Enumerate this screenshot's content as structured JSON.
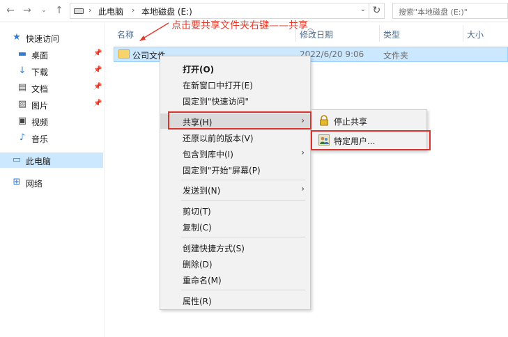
{
  "address_bar": {
    "crumbs": [
      "此电脑",
      "本地磁盘 (E:)"
    ],
    "search_placeholder": "搜索\"本地磁盘 (E:)\""
  },
  "sidebar": {
    "items": [
      {
        "label": "快速访问",
        "icon": "star-icon",
        "pinned": false
      },
      {
        "label": "桌面",
        "icon": "desktop-icon",
        "pinned": true
      },
      {
        "label": "下载",
        "icon": "download-icon",
        "pinned": true
      },
      {
        "label": "文档",
        "icon": "document-icon",
        "pinned": true
      },
      {
        "label": "图片",
        "icon": "picture-icon",
        "pinned": true
      },
      {
        "label": "视频",
        "icon": "video-icon",
        "pinned": false
      },
      {
        "label": "音乐",
        "icon": "music-icon",
        "pinned": false
      },
      {
        "label": "此电脑",
        "icon": "computer-icon",
        "selected": true
      },
      {
        "label": "网络",
        "icon": "network-icon"
      }
    ]
  },
  "columns": [
    "名称",
    "修改日期",
    "类型",
    "大小"
  ],
  "file_row": {
    "name": "公司文件",
    "date": "2022/6/20 9:06",
    "type": "文件夹"
  },
  "annotation": "点击要共享文件夹右键——共享",
  "context_menu": {
    "items": [
      {
        "label": "打开(O)",
        "bold": true
      },
      {
        "label": "在新窗口中打开(E)"
      },
      {
        "label": "固定到\"快速访问\""
      },
      {
        "label": "共享(H)",
        "submenu": true
      },
      {
        "label": "还原以前的版本(V)"
      },
      {
        "label": "包含到库中(I)",
        "submenu": true
      },
      {
        "label": "固定到\"开始\"屏幕(P)"
      },
      {
        "label": "发送到(N)",
        "submenu": true
      },
      {
        "label": "剪切(T)"
      },
      {
        "label": "复制(C)"
      },
      {
        "label": "创建快捷方式(S)"
      },
      {
        "label": "删除(D)"
      },
      {
        "label": "重命名(M)"
      },
      {
        "label": "属性(R)"
      }
    ]
  },
  "share_submenu": {
    "items": [
      {
        "label": "停止共享",
        "icon": "lock-icon"
      },
      {
        "label": "特定用户...",
        "icon": "users-icon"
      }
    ]
  },
  "colors": {
    "selection": "#cce8ff",
    "annotation_red": "#e23b2b",
    "menu_bg": "#f2f2f2"
  }
}
